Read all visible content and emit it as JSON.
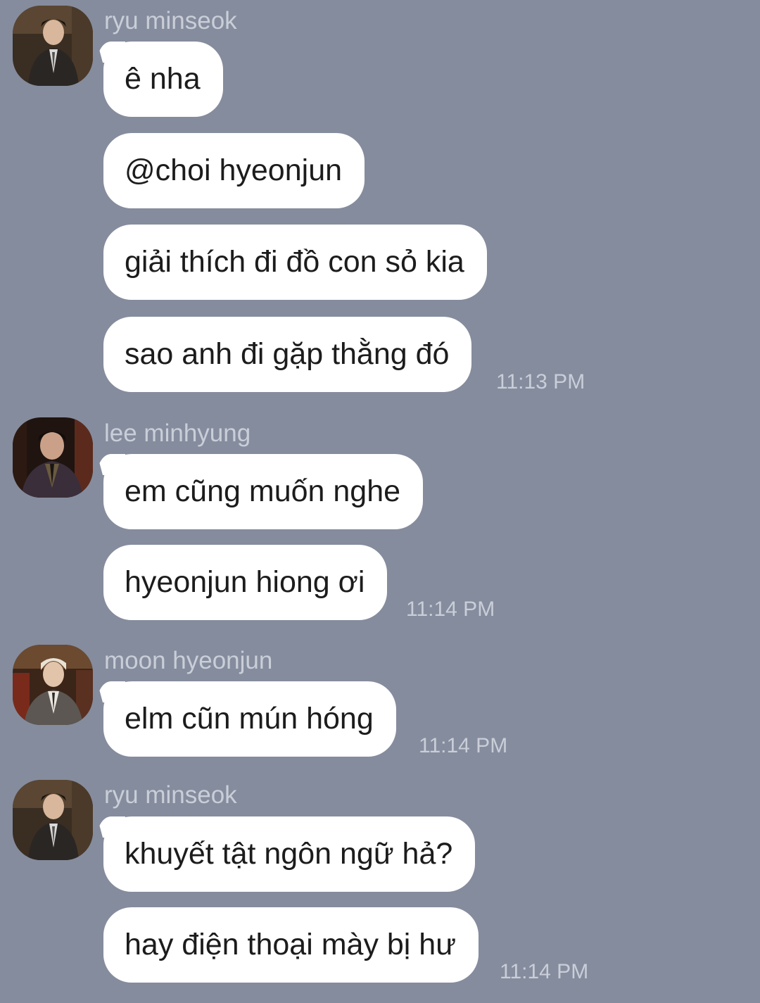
{
  "messages": [
    {
      "sender": "ryu minseok",
      "avatar": "ryu-minseok-avatar",
      "bubbles": [
        "ê nha",
        "@choi hyeonjun",
        "giải thích đi đồ con sỏ kia",
        "sao anh đi gặp thằng đó"
      ],
      "time": "11:13 PM"
    },
    {
      "sender": "lee minhyung",
      "avatar": "lee-minhyung-avatar",
      "bubbles": [
        "em cũng muốn nghe",
        "hyeonjun hiong ơi"
      ],
      "time": "11:14 PM"
    },
    {
      "sender": "moon hyeonjun",
      "avatar": "moon-hyeonjun-avatar",
      "bubbles": [
        "elm cũn mún hóng"
      ],
      "time": "11:14 PM"
    },
    {
      "sender": "ryu minseok",
      "avatar": "ryu-minseok-avatar",
      "bubbles": [
        "khuyết tật ngôn ngữ hả?",
        "hay điện thoại mày bị hư"
      ],
      "time": "11:14 PM"
    }
  ],
  "colors": {
    "background": "#858c9d",
    "bubble": "#ffffff",
    "meta_text": "#c9ced8",
    "message_text": "#1c1c1c"
  }
}
